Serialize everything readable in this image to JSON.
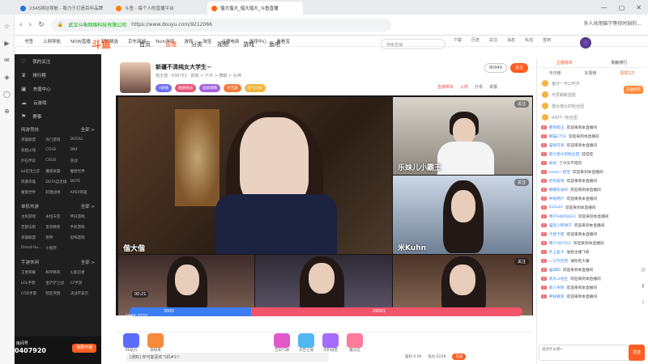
{
  "browser": {
    "tabs": [
      {
        "title": "2345网址导航 - 致力于打造百年品牌"
      },
      {
        "title": "斗鱼 - 每个人的直播平台"
      },
      {
        "title": "偕大偕大_偕大偕大_斗鱼直播"
      }
    ],
    "url_site": "武汉斗鱼网络科技有限公司",
    "url": "https://www.douyu.com/9212066",
    "url_right_text": "多人共用猫宁等待时刻的...",
    "bookmarks": [
      "书签",
      "上网导航",
      "NOW直播",
      "天猫精选",
      "京东商城",
      "Tech游戏",
      "游戏",
      "淘宝",
      "点播电商",
      "游戏中心",
      "看看宝"
    ]
  },
  "site": {
    "logo": "斗鱼",
    "nav": [
      "首页",
      "直播",
      "分类",
      "视频",
      "游戏",
      "鱼吧"
    ],
    "nav_active": "直播",
    "search_placeholder": "搜索直播",
    "right_nav": [
      "下载",
      "历史",
      "关注",
      "消息",
      "私信",
      "签到"
    ]
  },
  "sidebar": {
    "items": [
      {
        "label": "我的关注",
        "icon": "heart-icon"
      },
      {
        "label": "排行榜",
        "icon": "trophy-icon"
      },
      {
        "label": "充值中心",
        "icon": "wallet-icon"
      },
      {
        "label": "云游戏",
        "icon": "cloud-icon"
      },
      {
        "label": "赛事",
        "icon": "cup-icon"
      }
    ],
    "section1": {
      "title": "网游竞技",
      "more": "全部 >",
      "games": [
        "英雄联盟",
        "热门游戏",
        "DOTA2",
        "穿越火线",
        "CFHD",
        "DNF",
        "炉石传说",
        "CSGO",
        "逆战",
        "lol云顶之弈",
        "魔兽争霸",
        "魔兽世界",
        "风暴英雄",
        "DOTA自走棋",
        "DOTE",
        "魔兽世界",
        "刺激战场",
        "APEX英雄"
      ]
    },
    "section2": {
      "title": "单机热游",
      "more": "全部 >",
      "games": [
        "主机游戏",
        "永恒天空",
        "怀旧游戏",
        "无限法则",
        "反恐精英",
        "手机游戏",
        "英雄联盟",
        "原神",
        "恐怖游戏",
        "Dread Hu...",
        "小程序"
      ]
    },
    "section3": {
      "title": "手游休闲",
      "more": "全部 >",
      "games": [
        "王者荣耀",
        "和平精英",
        "火影忍者",
        "LOL手游",
        "金铲铲之战",
        "CF手游",
        "COD手游",
        "暗区突围",
        "决战平安京"
      ]
    },
    "room_no_label": "房间号",
    "room_no": "0407920",
    "open_button": "我要开播"
  },
  "room": {
    "title": "新疆不清纯女大学生~",
    "category": "颜值 > 户外 > 舞蹈 > 女神",
    "anchor": "偕大偕",
    "heat": "438752",
    "tags": [
      "V颜值",
      "魅惑挑战",
      "超级偶像",
      "才艺颜",
      "元气少女"
    ],
    "follow_count": "80944",
    "follow_label": "关注",
    "actions": [
      "直播带货",
      "火箭",
      "分享",
      "举报"
    ]
  },
  "video": {
    "labels": [
      "乐妹儿小霸王",
      "米Kuhn",
      "偕大偕",
      "阿尔法",
      "阿尔法王",
      "佳佳"
    ],
    "follow": [
      "关注",
      "关注",
      "关注"
    ],
    "timer": "00:21",
    "pk_left": "3003",
    "pk_right": "29001",
    "score_left": "1558",
    "score_right": "3337"
  },
  "gifts": [
    {
      "label": "PK助力",
      "color": "#5b6cff"
    },
    {
      "label": "快快来",
      "color": "#f58a3c"
    },
    {
      "label": "告白气球",
      "color": "#e05acb"
    },
    {
      "label": "天空之城",
      "color": "#4fb8f2"
    },
    {
      "label": "守护城堡",
      "color": "#a56cff"
    },
    {
      "label": "魔法信",
      "color": "#ff7a9b"
    }
  ],
  "chat_input_placeholder": "[通知] 你可能喜欢飞机#1!!",
  "bottom_info": [
    "猫利 0.00",
    "鱼丸 6228",
    "充值"
  ],
  "right_panel": {
    "tabs": [
      "主播榜单",
      "贡献排行"
    ],
    "sub_tabs": [
      "今日榜",
      "本周榜",
      "贵宾1万"
    ],
    "rank_items": [
      "鱼仔一可口可乐",
      "可爱萌新遗愿",
      "偕大偕大的粉丝团",
      "0437~粉丝团"
    ],
    "open_vip": "开通贵宾",
    "chats": [
      {
        "nm": "肥宅萌王",
        "msg": "欢迎来到本直播间"
      },
      {
        "nm": "狮猫2751",
        "msg": "欢迎来到本直播间"
      },
      {
        "nm": "猫咪可爱",
        "msg": "欢迎来到本直播间"
      },
      {
        "nm": "偕大偕大的粉丝团",
        "msg": "哇哇哇"
      },
      {
        "nm": "系统",
        "msg": "了今天不错的"
      },
      {
        "nm": "Lover~星空",
        "msg": "欢迎来到本直播间"
      },
      {
        "nm": "奶鸡爱情",
        "msg": "欢迎来到本直播间"
      },
      {
        "nm": "嘟嘟花发布",
        "msg": "欢迎来到本直播间"
      },
      {
        "nm": "神秘用户",
        "msg": "欢迎来到本直播间"
      },
      {
        "nm": "2o2u2z",
        "msg": "欢迎来到本直播间"
      },
      {
        "nm": "用户94859422",
        "msg": "欢迎来到本直播间"
      },
      {
        "nm": "猫吃小熊饼干",
        "msg": "欢迎来到本直播间"
      },
      {
        "nm": "卡娃卡娃",
        "msg": "欢迎来到本直播间"
      },
      {
        "nm": "用户387551",
        "msg": "欢迎来到本直播间"
      },
      {
        "nm": "叶上鱼干",
        "msg": "送给主播飞机"
      },
      {
        "nm": "一口气吃完",
        "msg": "请你吃大餐"
      },
      {
        "nm": "猫四四",
        "msg": "欢迎来到本直播间"
      },
      {
        "nm": "欢乐斗地主",
        "msg": "欢迎来到本直播间"
      },
      {
        "nm": "新人驾到",
        "msg": "欢迎来到本直播间"
      },
      {
        "nm": "神秘嘉宾",
        "msg": "欢迎来到本直播间"
      }
    ],
    "input_placeholder": "说点什么吧~",
    "send": "发送"
  }
}
